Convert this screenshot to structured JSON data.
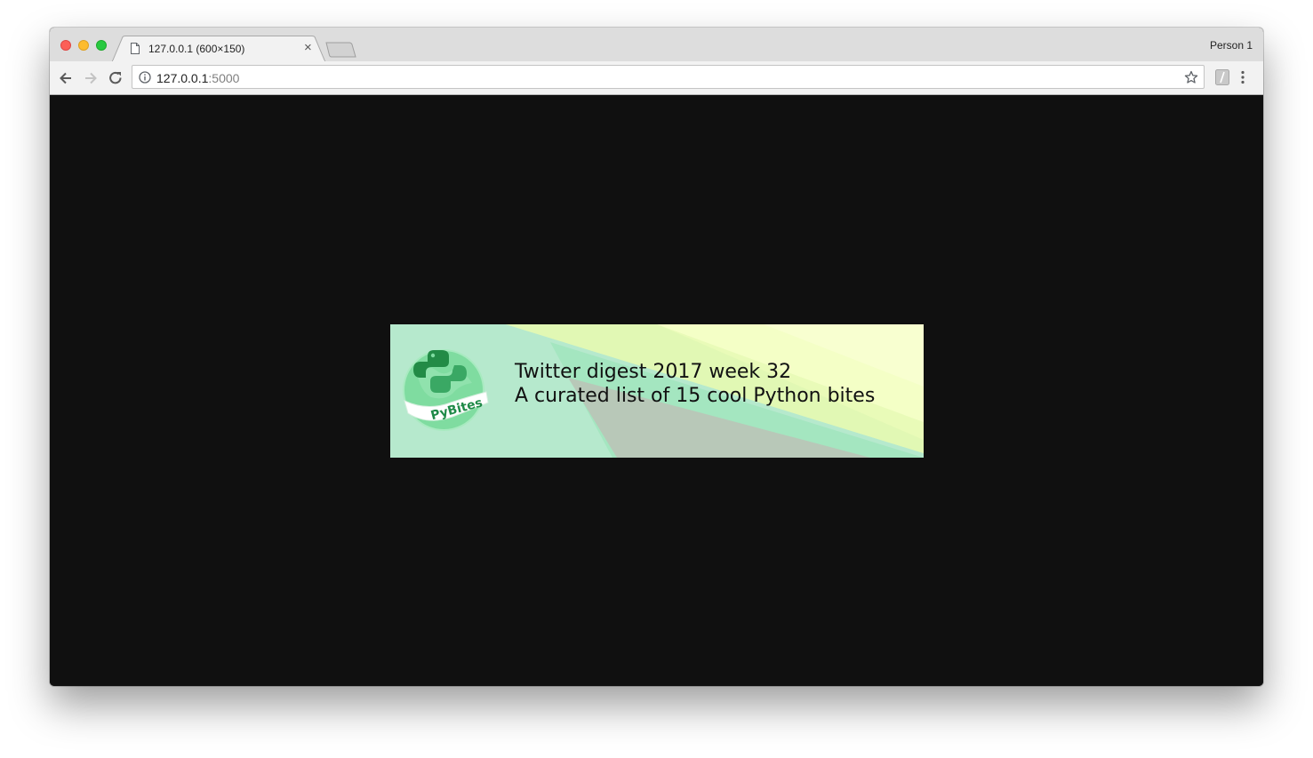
{
  "browser": {
    "tab": {
      "title": "127.0.0.1 (600×150)",
      "close_label": "×"
    },
    "profile": "Person 1",
    "address_bar": {
      "host": "127.0.0.1",
      "port": ":5000"
    },
    "icons": {
      "back": "arrow-back-icon",
      "forward": "arrow-forward-icon",
      "reload": "reload-icon",
      "info": "info-icon",
      "star": "star-icon",
      "extension": "extension-icon",
      "menu": "kebab-menu-icon"
    }
  },
  "banner": {
    "logo_text": "PyBites",
    "title": "Twitter digest 2017 week 32",
    "subtitle": "A curated list of 15 cool Python bites"
  },
  "colors": {
    "page_background": "#101010",
    "banner_green": "#b6e9cd",
    "banner_yellow": "#f6ffc4",
    "logo_green": "#2e9e5a"
  }
}
